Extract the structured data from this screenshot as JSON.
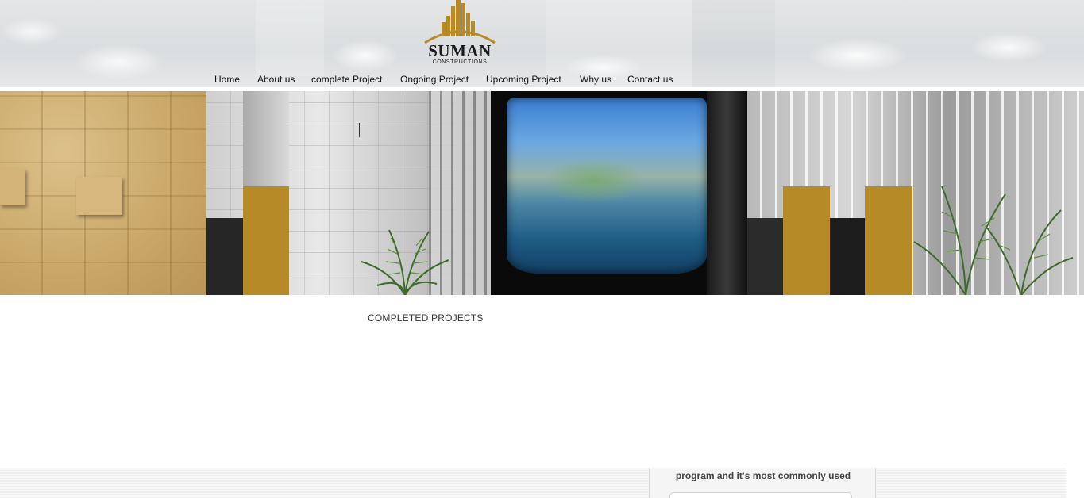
{
  "brand": {
    "name": "SUMAN",
    "tagline": "CONSTRUCTIONS",
    "accent_color": "#b78a28"
  },
  "nav": {
    "items": [
      {
        "label": "Home"
      },
      {
        "label": "About us"
      },
      {
        "label": "complete Project"
      },
      {
        "label": "Ongoing Project"
      },
      {
        "label": "Upcoming Project"
      },
      {
        "label": "Why us"
      },
      {
        "label": "Contact us"
      }
    ]
  },
  "main": {
    "section_title": "COMPLETED PROJECTS"
  },
  "footer": {
    "panel_text": "program and it's most commonly used"
  }
}
